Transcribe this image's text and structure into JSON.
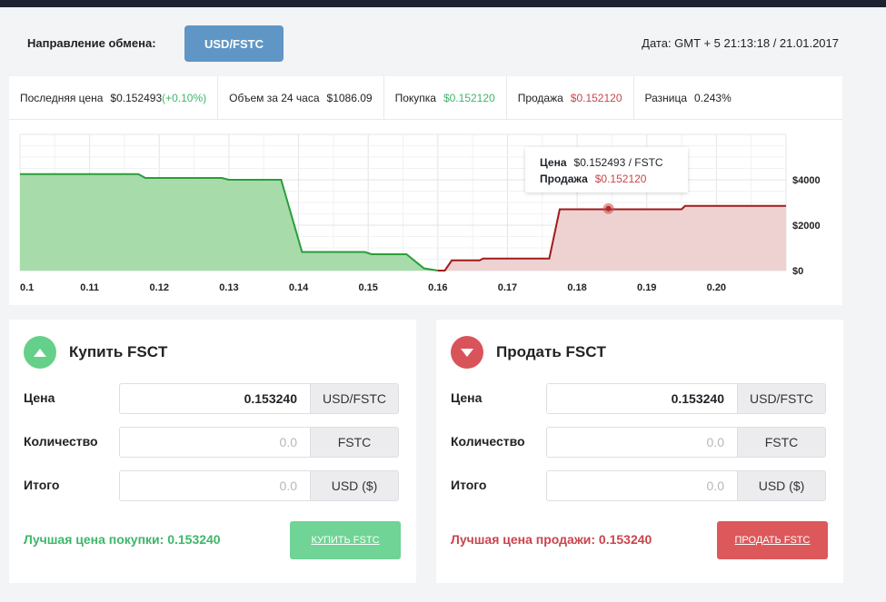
{
  "header": {
    "direction_label": "Направление обмена:",
    "pair_button": "USD/FSTC",
    "date": "Дата: GMT + 5 21:13:18  / 21.01.2017"
  },
  "stats": {
    "last_price_label": "Последняя цена",
    "last_price_value": "$0.152493",
    "last_price_change": "(+0.10%)",
    "volume_label": "Объем за 24 часа",
    "volume_value": "$1086.09",
    "buy_label": "Покупка",
    "buy_value": "$0.152120",
    "sell_label": "Продажа",
    "sell_value": "$0.152120",
    "spread_label": "Разница",
    "spread_value": "0.243%"
  },
  "chart_data": {
    "type": "area",
    "x_ticks": [
      "0.1",
      "0.11",
      "0.12",
      "0.13",
      "0.14",
      "0.15",
      "0.16",
      "0.17",
      "0.18",
      "0.19",
      "0.20"
    ],
    "y_ticks": [
      "$0",
      "$2000",
      "$4000"
    ],
    "xlim": [
      0.1,
      0.21
    ],
    "ylim": [
      0,
      6000
    ],
    "grid": true,
    "series": [
      {
        "color": "#2a9d3a",
        "fill": "#a7dcaa",
        "points": [
          [
            0.1,
            4250
          ],
          [
            0.117,
            4250
          ],
          [
            0.118,
            4080
          ],
          [
            0.129,
            4080
          ],
          [
            0.13,
            4000
          ],
          [
            0.1375,
            4000
          ],
          [
            0.1405,
            820
          ],
          [
            0.1495,
            820
          ],
          [
            0.1505,
            720
          ],
          [
            0.1555,
            720
          ],
          [
            0.158,
            100
          ],
          [
            0.16,
            0
          ]
        ]
      },
      {
        "color": "#a31b1b",
        "fill": "#eed2d2",
        "points": [
          [
            0.16,
            0
          ],
          [
            0.161,
            0
          ],
          [
            0.162,
            450
          ],
          [
            0.166,
            450
          ],
          [
            0.1665,
            530
          ],
          [
            0.176,
            530
          ],
          [
            0.1775,
            2700
          ],
          [
            0.195,
            2700
          ],
          [
            0.1955,
            2850
          ],
          [
            0.21,
            2850
          ]
        ]
      }
    ],
    "marker": [
      0.1845,
      2730
    ],
    "tooltip": {
      "price_label": "Цена",
      "price_value": "$0.152493 / FSTC",
      "sell_label": "Продажа",
      "sell_value": "$0.152120"
    }
  },
  "buy_form": {
    "title": "Купить FSCT",
    "price_label": "Цена",
    "price_value": "0.153240",
    "price_unit": "USD/FSTC",
    "qty_label": "Количество",
    "qty_placeholder": "0.0",
    "qty_unit": "FSTC",
    "total_label": "Итого",
    "total_placeholder": "0.0",
    "total_unit": "USD ($)",
    "best_price": "Лучшая цена покупки: 0.153240",
    "button": "КУПИТЬ FSTC"
  },
  "sell_form": {
    "title": "Продать FSCT",
    "price_label": "Цена",
    "price_value": "0.153240",
    "price_unit": "USD/FSTC",
    "qty_label": "Количество",
    "qty_placeholder": "0.0",
    "qty_unit": "FSTC",
    "total_label": "Итого",
    "total_placeholder": "0.0",
    "total_unit": "USD ($)",
    "best_price": "Лучшая цена продажи: 0.153240",
    "button": "ПРОДАТЬ FSTC"
  }
}
